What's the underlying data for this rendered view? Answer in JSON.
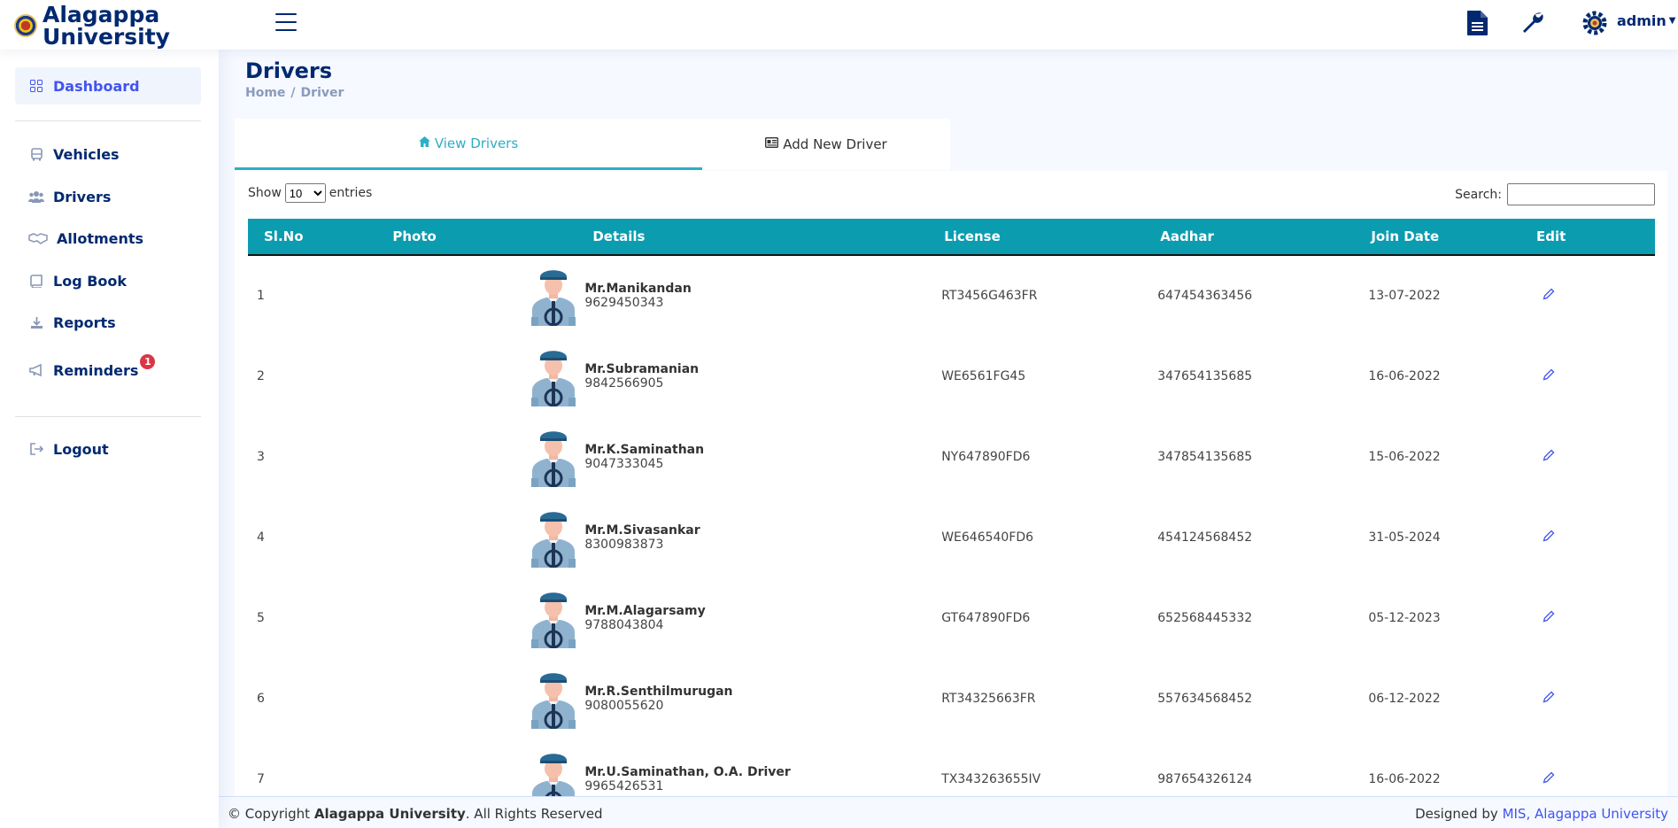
{
  "header": {
    "logo_line1": "Alagappa",
    "logo_line2": "University",
    "user": "admin"
  },
  "sidebar": {
    "items": [
      {
        "label": "Dashboard",
        "icon": "grid-icon"
      },
      {
        "label": "Vehicles",
        "icon": "bus-icon"
      },
      {
        "label": "Drivers",
        "icon": "people-icon"
      },
      {
        "label": "Allotments",
        "icon": "handshake-icon"
      },
      {
        "label": "Log Book",
        "icon": "journal-icon"
      },
      {
        "label": "Reports",
        "icon": "download-icon"
      },
      {
        "label": "Reminders",
        "icon": "megaphone-icon",
        "badge": "1"
      },
      {
        "label": "Logout",
        "icon": "logout-icon"
      }
    ]
  },
  "page": {
    "title": "Drivers",
    "breadcrumb": [
      "Home",
      "Driver"
    ]
  },
  "tabs": [
    {
      "label": "View Drivers",
      "icon": "home-icon",
      "active": true
    },
    {
      "label": "Add New Driver",
      "icon": "id-card-icon",
      "active": false
    }
  ],
  "table_controls": {
    "show_label": "Show",
    "entries_value": "10",
    "entries_label": "entries",
    "search_label": "Search:"
  },
  "table": {
    "columns": [
      "Sl.No",
      "Photo",
      "Details",
      "License",
      "Aadhar",
      "Join Date",
      "Edit"
    ],
    "rows": [
      {
        "sl": "1",
        "name": "Mr.Manikandan",
        "phone": "9629450343",
        "license": "RT3456G463FR",
        "aadhar": "647454363456",
        "join": "13-07-2022"
      },
      {
        "sl": "2",
        "name": "Mr.Subramanian",
        "phone": "9842566905",
        "license": "WE6561FG45",
        "aadhar": "347654135685",
        "join": "16-06-2022"
      },
      {
        "sl": "3",
        "name": "Mr.K.Saminathan",
        "phone": "9047333045",
        "license": "NY647890FD6",
        "aadhar": "347854135685",
        "join": "15-06-2022"
      },
      {
        "sl": "4",
        "name": "Mr.M.Sivasankar",
        "phone": "8300983873",
        "license": "WE646540FD6",
        "aadhar": "454124568452",
        "join": "31-05-2024"
      },
      {
        "sl": "5",
        "name": "Mr.M.Alagarsamy",
        "phone": "9788043804",
        "license": "GT647890FD6",
        "aadhar": "652568445332",
        "join": "05-12-2023"
      },
      {
        "sl": "6",
        "name": "Mr.R.Senthilmurugan",
        "phone": "9080055620",
        "license": "RT34325663FR",
        "aadhar": "557634568452",
        "join": "06-12-2022"
      },
      {
        "sl": "7",
        "name": "Mr.U.Saminathan, O.A. Driver",
        "phone": "9965426531",
        "license": "TX343263655IV",
        "aadhar": "987654326124",
        "join": "16-06-2022"
      }
    ]
  },
  "footer": {
    "copyright_prefix": "© Copyright",
    "org": "Alagappa University",
    "rights": ". All Rights Reserved",
    "designed_by": "Designed by",
    "designer": "MIS, Alagappa University"
  },
  "colors": {
    "brand": "#012970",
    "accent": "#4154f1",
    "table_header": "#0b9cb0",
    "tab_active": "#2eaec4",
    "badge": "#dc3545"
  }
}
